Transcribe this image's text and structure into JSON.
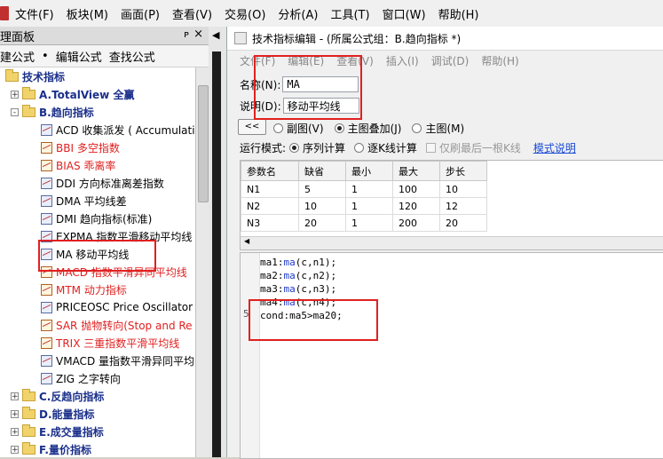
{
  "menubar": {
    "items": [
      "文件(F)",
      "板块(M)",
      "画面(P)",
      "查看(V)",
      "交易(O)",
      "分析(A)",
      "工具(T)",
      "窗口(W)",
      "帮助(H)"
    ]
  },
  "left_panel": {
    "title": "理面板",
    "pin": "ᴘ",
    "close": "×",
    "tools": [
      "建公式",
      "编辑公式",
      "查找公式"
    ],
    "tree": [
      {
        "label": "技术指标",
        "level": 0,
        "type": "folder",
        "style": "blue"
      },
      {
        "label": "A.TotalView 全赢",
        "level": 1,
        "type": "folder",
        "style": "blue",
        "exp": "+"
      },
      {
        "label": "B.趋向指标",
        "level": 1,
        "type": "folder",
        "style": "blue",
        "exp": "-"
      },
      {
        "label": "ACD 收集派发 ( Accumulati",
        "level": 2,
        "type": "formula",
        "style": "normal"
      },
      {
        "label": "BBI 多空指数",
        "level": 2,
        "type": "formula",
        "style": "red"
      },
      {
        "label": "BIAS 乖离率",
        "level": 2,
        "type": "formula",
        "style": "red"
      },
      {
        "label": "DDI 方向标准离差指数",
        "level": 2,
        "type": "formula",
        "style": "normal"
      },
      {
        "label": "DMA 平均线差",
        "level": 2,
        "type": "formula",
        "style": "normal"
      },
      {
        "label": "DMI 趋向指标(标准)",
        "level": 2,
        "type": "formula",
        "style": "normal"
      },
      {
        "label": "EXPMA 指数平滑移动平均线",
        "level": 2,
        "type": "formula",
        "style": "normal"
      },
      {
        "label": "MA 移动平均线",
        "level": 2,
        "type": "formula",
        "style": "normal"
      },
      {
        "label": "MACD 指数平滑异同平均线",
        "level": 2,
        "type": "formula",
        "style": "red"
      },
      {
        "label": "MTM 动力指标",
        "level": 2,
        "type": "formula",
        "style": "red"
      },
      {
        "label": "PRICEOSC Price Oscillator",
        "level": 2,
        "type": "formula",
        "style": "normal"
      },
      {
        "label": "SAR 抛物转向(Stop and Re",
        "level": 2,
        "type": "formula",
        "style": "red"
      },
      {
        "label": "TRIX 三重指数平滑平均线",
        "level": 2,
        "type": "formula",
        "style": "red"
      },
      {
        "label": "VMACD 量指数平滑异同平均",
        "level": 2,
        "type": "formula",
        "style": "normal"
      },
      {
        "label": "ZIG 之字转向",
        "level": 2,
        "type": "formula",
        "style": "normal"
      },
      {
        "label": "C.反趋向指标",
        "level": 1,
        "type": "folder",
        "style": "blue",
        "exp": "+"
      },
      {
        "label": "D.能量指标",
        "level": 1,
        "type": "folder",
        "style": "blue",
        "exp": "+"
      },
      {
        "label": "E.成交量指标",
        "level": 1,
        "type": "folder",
        "style": "blue",
        "exp": "+"
      },
      {
        "label": "F.量价指标",
        "level": 1,
        "type": "folder",
        "style": "blue",
        "exp": "+"
      }
    ]
  },
  "splitter": {
    "arrow": "◀"
  },
  "dialog": {
    "title": "技术指标编辑 - (所属公式组：B.趋向指标 *)",
    "menu": [
      "文件(F)",
      "编辑(E)",
      "查看(V)",
      "插入(I)",
      "调试(D)",
      "帮助(H)"
    ],
    "name_label": "名称(N):",
    "name_value": "MA",
    "desc_label": "说明(D):",
    "desc_value": "移动平均线",
    "back_button": "<<",
    "pos_options": [
      "副图(V)",
      "主图叠加(J)",
      "主图(M)"
    ],
    "run_mode_label": "运行模式:",
    "run_options": [
      "序列计算",
      "逐K线计算"
    ],
    "last_bar_label": "仅刷最后一根K线",
    "mode_help": "模式说明",
    "params_headers": [
      "参数名",
      "缺省",
      "最小",
      "最大",
      "步长"
    ],
    "params_rows": [
      [
        "N1",
        "5",
        "1",
        "100",
        "10"
      ],
      [
        "N2",
        "10",
        "1",
        "120",
        "12"
      ],
      [
        "N3",
        "20",
        "1",
        "200",
        "20"
      ]
    ],
    "code_lines": [
      {
        "var": "ma1",
        "fn": "ma",
        "args": "(c,n1);"
      },
      {
        "var": "ma2",
        "fn": "ma",
        "args": "(c,n2);"
      },
      {
        "var": "ma3",
        "fn": "ma",
        "args": "(c,n3);"
      },
      {
        "var": "ma4",
        "fn": "ma",
        "args": "(c,n4);"
      },
      {
        "var": "cond",
        "fn": "",
        "args": "ma5>ma20;"
      }
    ],
    "line_number_shown": "5"
  }
}
